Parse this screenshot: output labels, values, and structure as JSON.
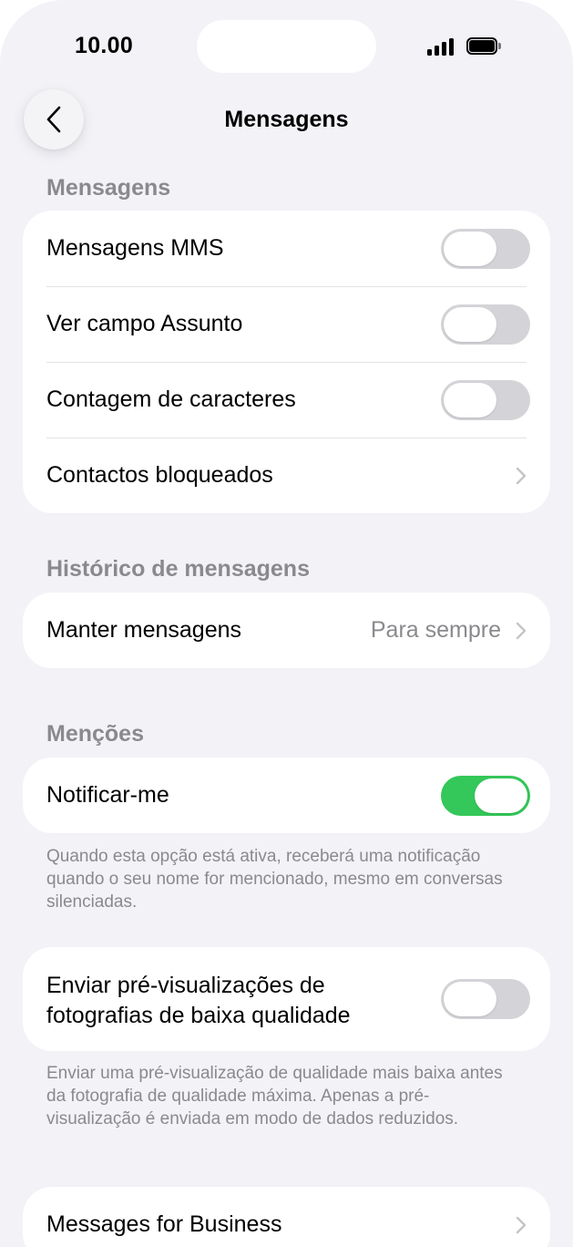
{
  "status_bar": {
    "time": "10.00"
  },
  "nav": {
    "title": "Mensagens"
  },
  "sections": {
    "mensagens": {
      "header": "Mensagens",
      "mms_label": "Mensagens MMS",
      "mms_on": false,
      "subject_label": "Ver campo Assunto",
      "subject_on": false,
      "char_count_label": "Contagem de caracteres",
      "char_count_on": false,
      "blocked_label": "Contactos bloqueados"
    },
    "historico": {
      "header": "Histórico de mensagens",
      "keep_label": "Manter mensagens",
      "keep_value": "Para sempre"
    },
    "mencoes": {
      "header": "Menções",
      "notify_label": "Notificar-me",
      "notify_on": true,
      "footer": "Quando esta opção está ativa, receberá uma notificação quando o seu nome for mencionado, mesmo em conversas silenciadas."
    },
    "previews": {
      "label_line1": "Enviar pré-visualizações de",
      "label_line2": "fotografias de baixa qualidade",
      "on": false,
      "footer": "Enviar uma pré-visualização de qualidade mais baixa antes da fotografia de qualidade máxima. Apenas a pré-visualização é enviada em modo de dados reduzidos."
    },
    "business": {
      "label": "Messages for Business"
    }
  },
  "colors": {
    "background": "#f2f2f7",
    "toggle_on": "#34c759",
    "toggle_off": "#d4d4d8",
    "secondary_text": "#8a8a8e"
  },
  "icons": [
    "back-chevron-icon",
    "chevron-right-icon",
    "signal-icon",
    "battery-icon"
  ]
}
